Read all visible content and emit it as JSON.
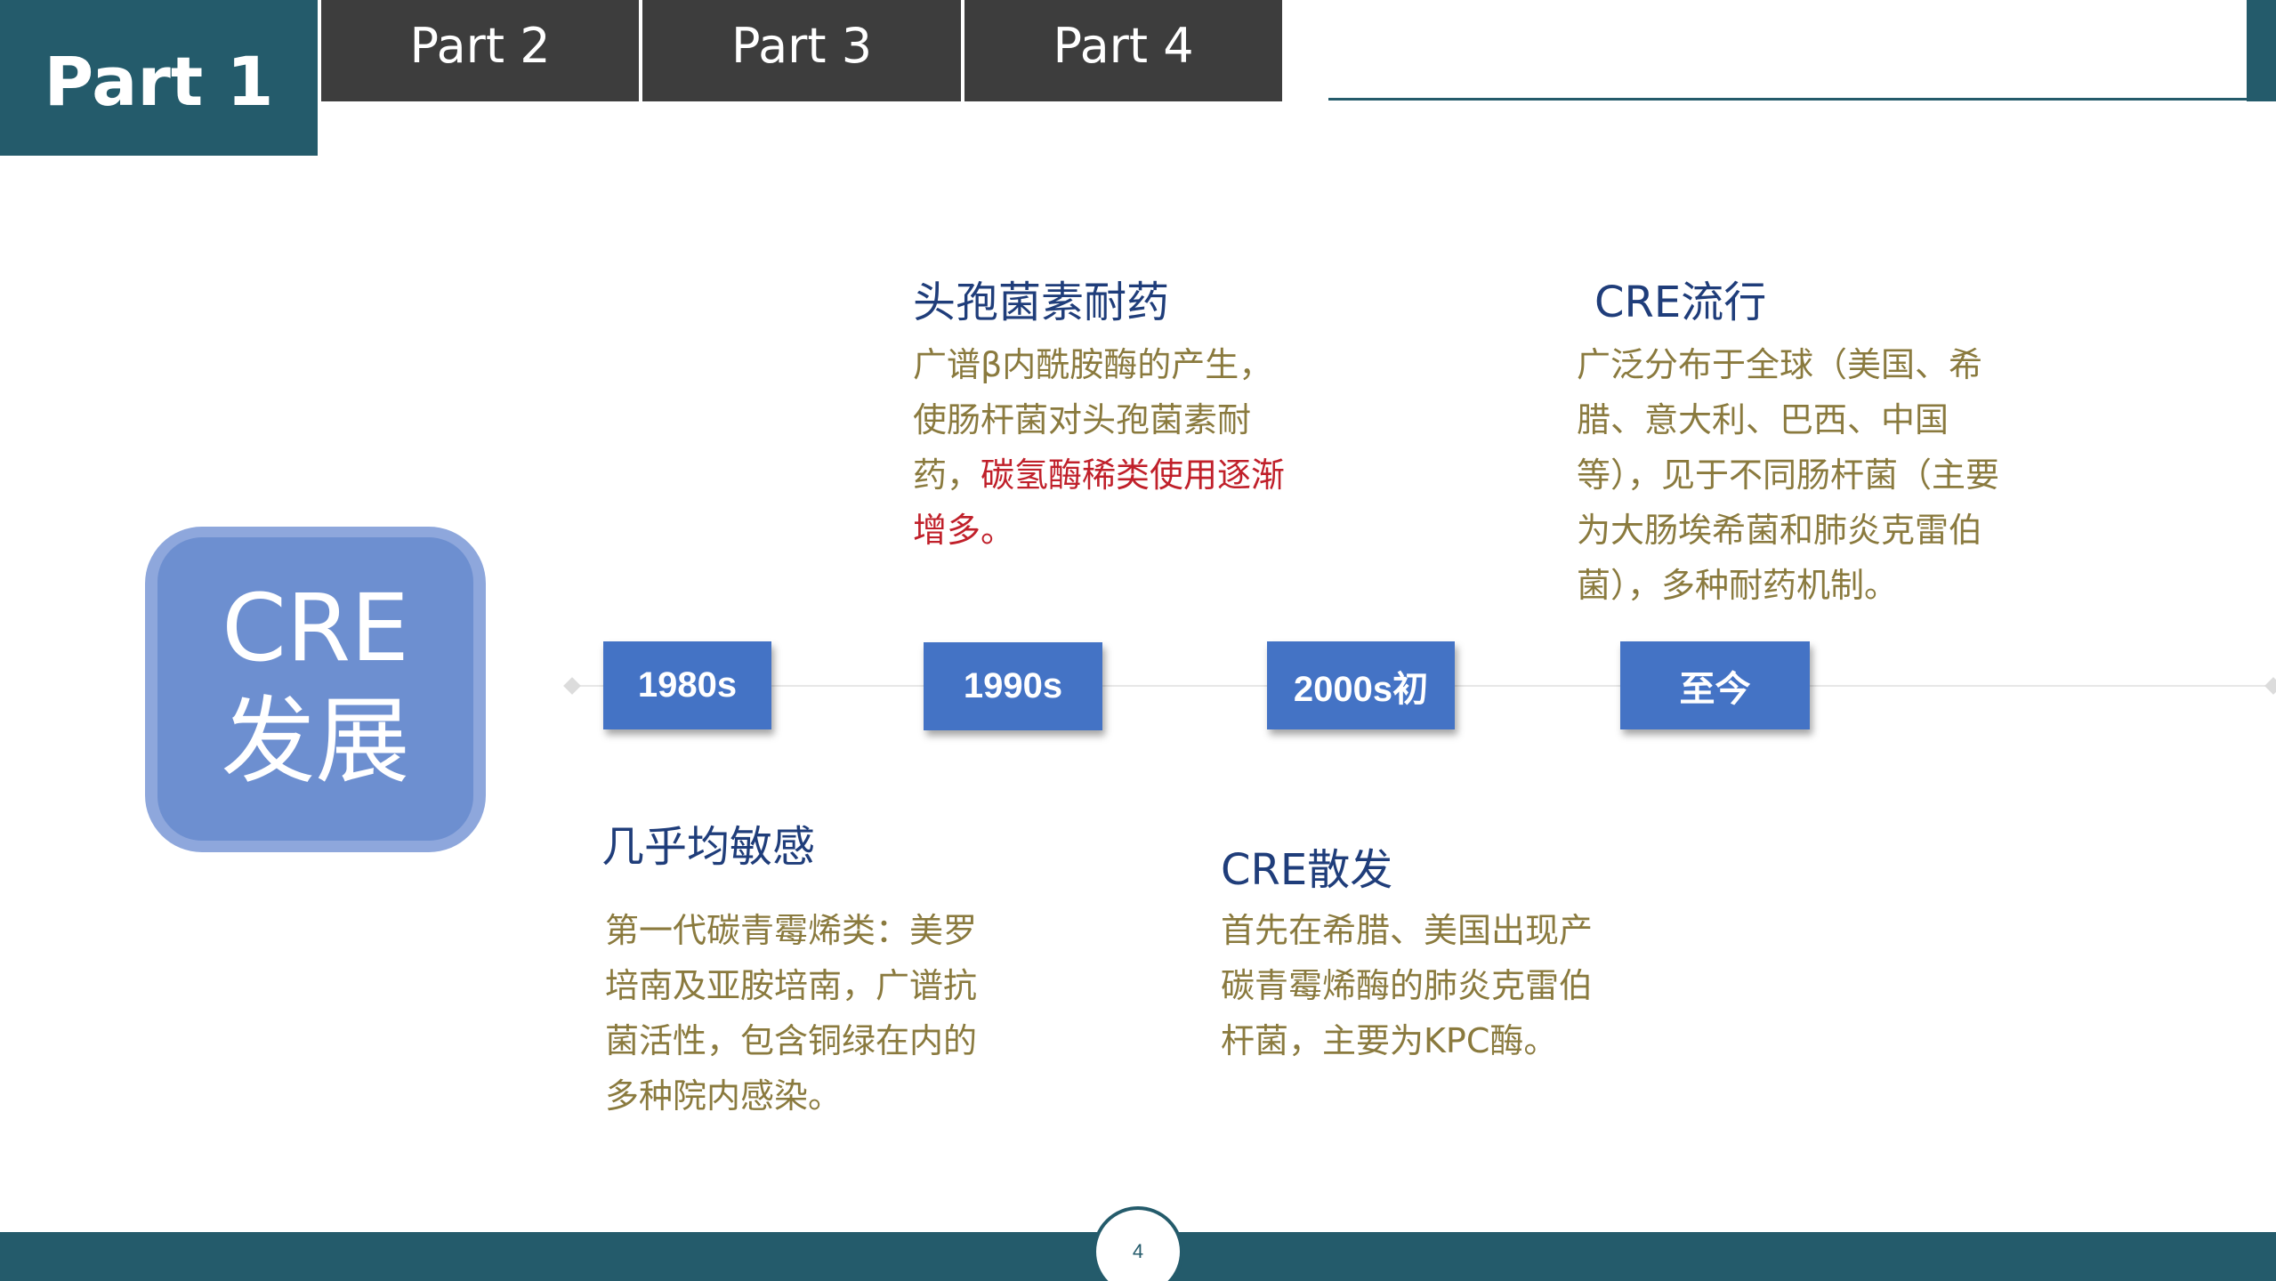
{
  "tabs": {
    "active": "Part 1",
    "others": [
      "Part 2",
      "Part 3",
      "Part 4"
    ]
  },
  "badge": {
    "line1": "CRE",
    "line2": "发展"
  },
  "timeline": {
    "eras": [
      "1980s",
      "1990s",
      "2000s初",
      "至今"
    ]
  },
  "events": {
    "e1980": {
      "heading": "几乎均敏感",
      "body": "第一代碳青霉烯类：美罗培南及亚胺培南，广谱抗菌活性，包含铜绿在内的多种院内感染。"
    },
    "e1990": {
      "heading": "头孢菌素耐药",
      "body_normal": "广谱β内酰胺酶的产生，使肠杆菌对头孢菌素耐药，",
      "body_highlight": "碳氢酶稀类使用逐渐增多。"
    },
    "e2000": {
      "heading": "CRE散发",
      "body": "首先在希腊、美国出现产碳青霉烯酶的肺炎克雷伯杆菌，主要为KPC酶。"
    },
    "now": {
      "heading": "CRE流行",
      "body": "广泛分布于全球（美国、希腊、意大利、巴西、中国等），见于不同肠杆菌（主要为大肠埃希菌和肺炎克雷伯菌），多种耐药机制。"
    }
  },
  "footer": {
    "page_number": "4"
  },
  "colors": {
    "header_teal": "#245b6b",
    "tab_gray": "#3d3d3d",
    "era_blue": "#4473c5",
    "badge_blue": "#6d8fd0",
    "heading_navy": "#1f3d7a",
    "body_olive": "#8a7a3e",
    "highlight_red": "#c0202a"
  }
}
